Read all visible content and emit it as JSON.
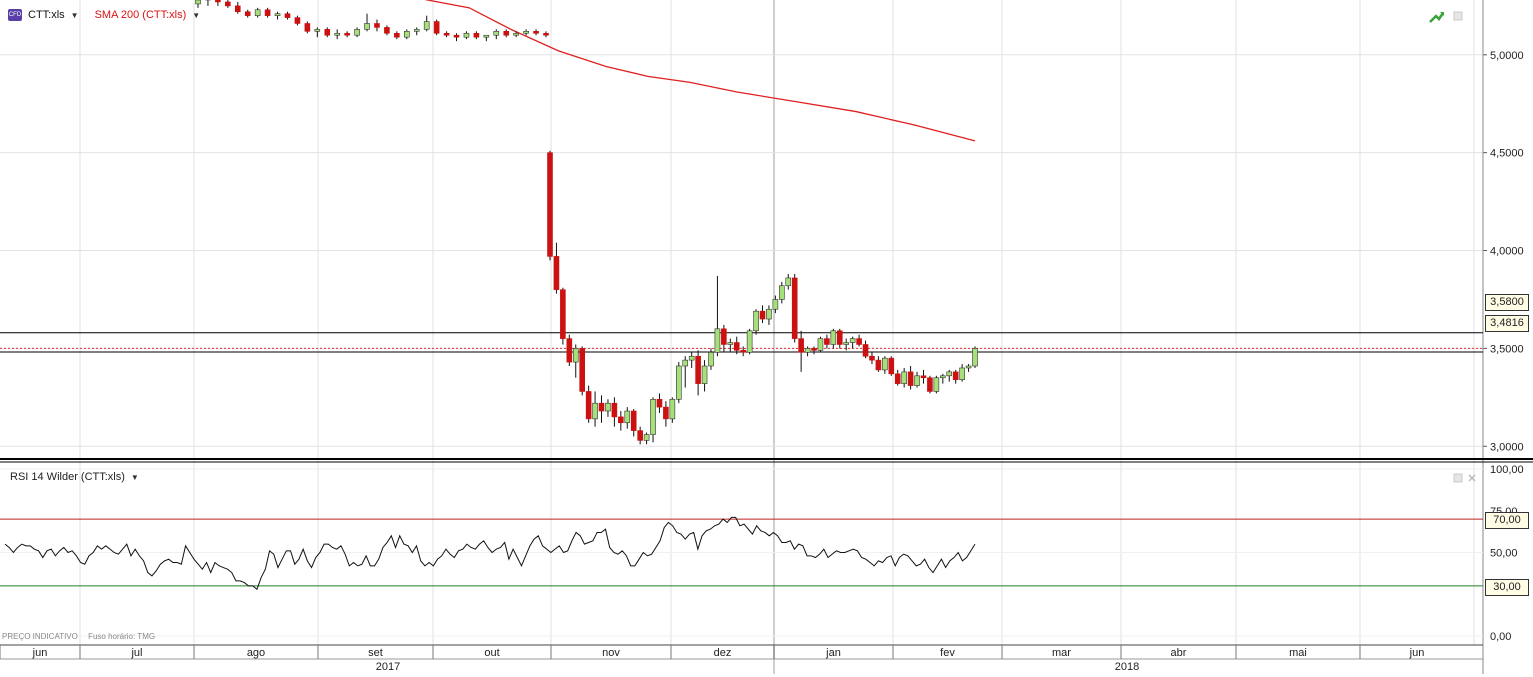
{
  "legend": {
    "badge": "CFD",
    "ticker": "CTT:xls",
    "sma": "SMA 200 (CTT:xls)"
  },
  "rsi_legend": {
    "label": "RSI 14 Wilder (CTT:xls)"
  },
  "price_tags": {
    "upper": "3,5800",
    "lower": "3,4816"
  },
  "rsi_tags": {
    "upper": "70,00",
    "lower": "30,00"
  },
  "footer": {
    "note": "PREÇO INDICATIVO",
    "timezone": "Fuso horário: TMG"
  },
  "colors": {
    "up": "#a6e07a",
    "down": "#cc1111",
    "sma": "#e02020",
    "rsi_line": "#111111",
    "rsi_upper": "#c02020",
    "rsi_lower": "#208020"
  },
  "icons": {
    "toolbar_trend": "trend-arrow-icon",
    "toolbar_close": "panel-close-icon"
  },
  "chart_data": [
    {
      "type": "candlestick",
      "title": "CTT:xls",
      "y_ticks": [
        "3,0000",
        "3,5000",
        "4,0000",
        "4,5000",
        "5,0000"
      ],
      "ylim": [
        2.99,
        5.27
      ],
      "x_tick_labels": [
        "jun",
        "jul",
        "ago",
        "set",
        "out",
        "nov",
        "dez",
        "jan",
        "fev",
        "mar",
        "abr",
        "mai",
        "jun"
      ],
      "year_labels": [
        "2017",
        "2018"
      ],
      "horizontal_lines": [
        3.58,
        3.4816
      ],
      "sma_200": {
        "name": "SMA 200 (CTT:xls)",
        "points": [
          [
            0.0,
            5.33
          ],
          [
            0.08,
            5.28
          ],
          [
            0.15,
            5.24
          ],
          [
            0.22,
            5.13
          ],
          [
            0.3,
            5.02
          ],
          [
            0.38,
            4.94
          ],
          [
            0.45,
            4.89
          ],
          [
            0.52,
            4.86
          ],
          [
            0.6,
            4.81
          ],
          [
            0.7,
            4.76
          ],
          [
            0.8,
            4.71
          ],
          [
            0.9,
            4.64
          ],
          [
            1.0,
            4.56
          ]
        ]
      },
      "candles": [
        [
          5.26,
          5.3,
          5.24,
          5.28
        ],
        [
          5.28,
          5.32,
          5.25,
          5.3
        ],
        [
          5.3,
          5.31,
          5.25,
          5.27
        ],
        [
          5.27,
          5.29,
          5.24,
          5.25
        ],
        [
          5.25,
          5.27,
          5.21,
          5.22
        ],
        [
          5.22,
          5.23,
          5.19,
          5.2
        ],
        [
          5.2,
          5.24,
          5.19,
          5.23
        ],
        [
          5.23,
          5.24,
          5.19,
          5.2
        ],
        [
          5.2,
          5.22,
          5.18,
          5.21
        ],
        [
          5.21,
          5.22,
          5.18,
          5.19
        ],
        [
          5.19,
          5.2,
          5.15,
          5.16
        ],
        [
          5.16,
          5.17,
          5.11,
          5.12
        ],
        [
          5.12,
          5.14,
          5.09,
          5.13
        ],
        [
          5.13,
          5.14,
          5.09,
          5.1
        ],
        [
          5.1,
          5.13,
          5.08,
          5.11
        ],
        [
          5.11,
          5.12,
          5.09,
          5.1
        ],
        [
          5.1,
          5.14,
          5.09,
          5.13
        ],
        [
          5.13,
          5.21,
          5.12,
          5.16
        ],
        [
          5.16,
          5.18,
          5.12,
          5.14
        ],
        [
          5.14,
          5.15,
          5.1,
          5.11
        ],
        [
          5.11,
          5.12,
          5.08,
          5.09
        ],
        [
          5.09,
          5.13,
          5.08,
          5.12
        ],
        [
          5.12,
          5.14,
          5.1,
          5.13
        ],
        [
          5.13,
          5.2,
          5.12,
          5.17
        ],
        [
          5.17,
          5.18,
          5.1,
          5.11
        ],
        [
          5.11,
          5.12,
          5.09,
          5.1
        ],
        [
          5.1,
          5.11,
          5.07,
          5.09
        ],
        [
          5.09,
          5.12,
          5.08,
          5.11
        ],
        [
          5.11,
          5.12,
          5.08,
          5.09
        ],
        [
          5.09,
          5.1,
          5.07,
          5.1
        ],
        [
          5.1,
          5.13,
          5.08,
          5.12
        ],
        [
          5.12,
          5.13,
          5.09,
          5.1
        ],
        [
          5.1,
          5.12,
          5.09,
          5.11
        ],
        [
          5.11,
          5.13,
          5.1,
          5.12
        ],
        [
          5.12,
          5.13,
          5.1,
          5.11
        ],
        [
          5.11,
          5.12,
          5.09,
          5.1
        ],
        [
          4.5,
          4.51,
          3.95,
          3.97
        ],
        [
          3.97,
          4.04,
          3.78,
          3.8
        ],
        [
          3.8,
          3.81,
          3.52,
          3.55
        ],
        [
          3.55,
          3.57,
          3.41,
          3.43
        ],
        [
          3.43,
          3.52,
          3.35,
          3.5
        ],
        [
          3.5,
          3.51,
          3.26,
          3.28
        ],
        [
          3.28,
          3.31,
          3.12,
          3.14
        ],
        [
          3.14,
          3.28,
          3.1,
          3.22
        ],
        [
          3.22,
          3.26,
          3.12,
          3.18
        ],
        [
          3.18,
          3.24,
          3.15,
          3.22
        ],
        [
          3.22,
          3.25,
          3.1,
          3.15
        ],
        [
          3.15,
          3.18,
          3.08,
          3.12
        ],
        [
          3.12,
          3.2,
          3.09,
          3.18
        ],
        [
          3.18,
          3.19,
          3.05,
          3.08
        ],
        [
          3.08,
          3.1,
          3.01,
          3.03
        ],
        [
          3.03,
          3.07,
          3.01,
          3.06
        ],
        [
          3.06,
          3.25,
          3.02,
          3.24
        ],
        [
          3.24,
          3.27,
          3.17,
          3.2
        ],
        [
          3.2,
          3.23,
          3.1,
          3.14
        ],
        [
          3.14,
          3.25,
          3.12,
          3.24
        ],
        [
          3.24,
          3.43,
          3.22,
          3.41
        ],
        [
          3.41,
          3.46,
          3.3,
          3.44
        ],
        [
          3.44,
          3.48,
          3.4,
          3.46
        ],
        [
          3.46,
          3.49,
          3.26,
          3.32
        ],
        [
          3.32,
          3.44,
          3.28,
          3.41
        ],
        [
          3.41,
          3.5,
          3.39,
          3.48
        ],
        [
          3.48,
          3.87,
          3.46,
          3.6
        ],
        [
          3.6,
          3.62,
          3.48,
          3.52
        ],
        [
          3.52,
          3.55,
          3.48,
          3.53
        ],
        [
          3.53,
          3.56,
          3.47,
          3.49
        ],
        [
          3.49,
          3.51,
          3.46,
          3.48
        ],
        [
          3.48,
          3.6,
          3.47,
          3.59
        ],
        [
          3.59,
          3.7,
          3.57,
          3.69
        ],
        [
          3.69,
          3.72,
          3.63,
          3.65
        ],
        [
          3.65,
          3.72,
          3.62,
          3.7
        ],
        [
          3.7,
          3.77,
          3.68,
          3.75
        ],
        [
          3.75,
          3.84,
          3.73,
          3.82
        ],
        [
          3.82,
          3.88,
          3.8,
          3.86
        ],
        [
          3.86,
          3.88,
          3.53,
          3.55
        ],
        [
          3.55,
          3.59,
          3.38,
          3.48
        ],
        [
          3.48,
          3.51,
          3.46,
          3.5
        ],
        [
          3.5,
          3.51,
          3.47,
          3.49
        ],
        [
          3.49,
          3.56,
          3.48,
          3.55
        ],
        [
          3.55,
          3.57,
          3.5,
          3.52
        ],
        [
          3.52,
          3.6,
          3.5,
          3.59
        ],
        [
          3.59,
          3.6,
          3.5,
          3.52
        ],
        [
          3.52,
          3.55,
          3.49,
          3.53
        ],
        [
          3.53,
          3.56,
          3.5,
          3.55
        ],
        [
          3.55,
          3.57,
          3.51,
          3.52
        ],
        [
          3.52,
          3.54,
          3.45,
          3.46
        ],
        [
          3.46,
          3.48,
          3.42,
          3.44
        ],
        [
          3.44,
          3.46,
          3.38,
          3.39
        ],
        [
          3.39,
          3.46,
          3.37,
          3.45
        ],
        [
          3.45,
          3.46,
          3.36,
          3.37
        ],
        [
          3.37,
          3.39,
          3.31,
          3.32
        ],
        [
          3.32,
          3.4,
          3.3,
          3.38
        ],
        [
          3.38,
          3.41,
          3.29,
          3.31
        ],
        [
          3.31,
          3.38,
          3.3,
          3.36
        ],
        [
          3.36,
          3.39,
          3.32,
          3.35
        ],
        [
          3.35,
          3.36,
          3.27,
          3.28
        ],
        [
          3.28,
          3.36,
          3.27,
          3.35
        ],
        [
          3.35,
          3.37,
          3.32,
          3.36
        ],
        [
          3.36,
          3.39,
          3.33,
          3.38
        ],
        [
          3.38,
          3.39,
          3.32,
          3.34
        ],
        [
          3.34,
          3.42,
          3.33,
          3.4
        ],
        [
          3.4,
          3.42,
          3.38,
          3.41
        ],
        [
          3.41,
          3.51,
          3.4,
          3.5
        ]
      ]
    },
    {
      "type": "line",
      "title": "RSI 14 Wilder (CTT:xls)",
      "y_ticks": [
        "0,00",
        "25,00",
        "50,00",
        "75,00",
        "100,00"
      ],
      "ylim": [
        0,
        100
      ],
      "reference_lines": [
        70,
        30
      ],
      "values": [
        55,
        53,
        50,
        53,
        55,
        54,
        54,
        52,
        51,
        47,
        51,
        52,
        48,
        51,
        53,
        50,
        51,
        48,
        44,
        43,
        48,
        50,
        54,
        52,
        54,
        52,
        50,
        49,
        52,
        55,
        48,
        52,
        48,
        45,
        38,
        36,
        39,
        43,
        45,
        46,
        44,
        44,
        43,
        54,
        50,
        46,
        43,
        40,
        44,
        38,
        44,
        42,
        41,
        40,
        38,
        33,
        33,
        32,
        30,
        30,
        28,
        35,
        40,
        51,
        49,
        41,
        46,
        51,
        51,
        43,
        46,
        52,
        45,
        41,
        47,
        50,
        55,
        55,
        53,
        52,
        54,
        49,
        42,
        44,
        42,
        43,
        48,
        42,
        42,
        46,
        53,
        56,
        60,
        53,
        60,
        55,
        54,
        50,
        54,
        45,
        42,
        44,
        42,
        46,
        48,
        52,
        49,
        47,
        51,
        52,
        55,
        53,
        52,
        55,
        57,
        53,
        50,
        52,
        53,
        56,
        46,
        52,
        47,
        42,
        48,
        54,
        58,
        60,
        54,
        52,
        50,
        52,
        54,
        50,
        51,
        57,
        62,
        60,
        55,
        56,
        57,
        62,
        62,
        64,
        53,
        50,
        49,
        51,
        48,
        42,
        42,
        46,
        50,
        48,
        49,
        53,
        57,
        65,
        68,
        66,
        62,
        61,
        58,
        61,
        62,
        52,
        60,
        63,
        64,
        66,
        67,
        70,
        68,
        71,
        71,
        66,
        67,
        64,
        61,
        66,
        63,
        62,
        60,
        62,
        60,
        56,
        56,
        57,
        52,
        55,
        54,
        48,
        48,
        47,
        49,
        52,
        47,
        49,
        51,
        50,
        50,
        51,
        52,
        51,
        47,
        46,
        44,
        42,
        45,
        44,
        47,
        48,
        42,
        47,
        49,
        48,
        45,
        42,
        43,
        46,
        41,
        38,
        42,
        46,
        41,
        45,
        47,
        50,
        45,
        47,
        51,
        55
      ],
      "rsi_fine": true
    }
  ]
}
